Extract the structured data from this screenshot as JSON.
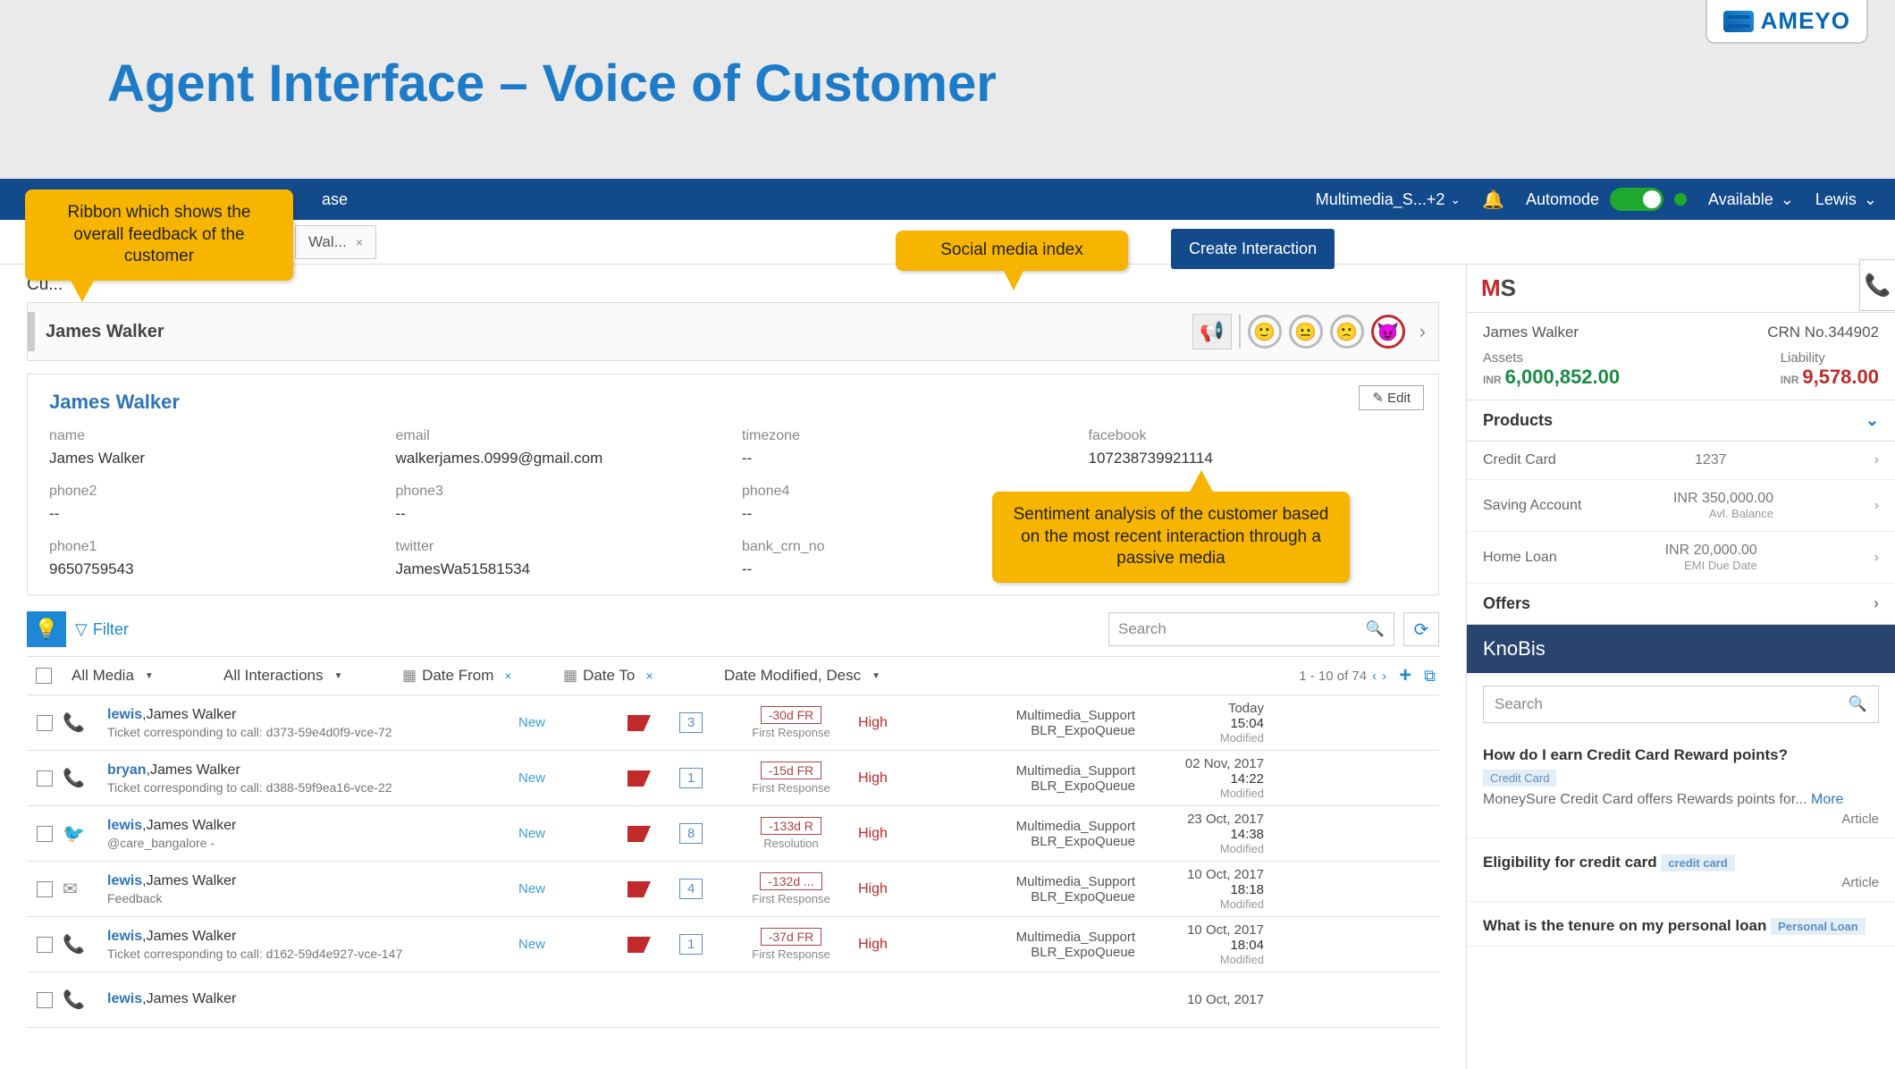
{
  "slide": {
    "title": "Agent Interface – Voice of Customer",
    "logo": "AMEYO"
  },
  "topbar": {
    "breadcrumb_suffix": "ase",
    "profile": "Multimedia_S...+2",
    "automode": "Automode",
    "status": "Available",
    "user": "Lewis"
  },
  "tab": {
    "label": "Wal...",
    "close": "×"
  },
  "create_btn": "Create Interaction",
  "cust_label": "Cu...",
  "ribbon": {
    "name": "James Walker"
  },
  "detail": {
    "title": "James Walker",
    "edit": "✎  Edit",
    "fields": [
      {
        "lbl": "name",
        "val": "James Walker"
      },
      {
        "lbl": "email",
        "val": "walkerjames.0999@gmail.com"
      },
      {
        "lbl": "timezone",
        "val": "--"
      },
      {
        "lbl": "facebook",
        "val": "107238739921114"
      },
      {
        "lbl": "phone2",
        "val": "--"
      },
      {
        "lbl": "phone3",
        "val": "--"
      },
      {
        "lbl": "phone4",
        "val": "--"
      },
      {
        "lbl": "",
        "val": ""
      },
      {
        "lbl": "phone1",
        "val": "9650759543"
      },
      {
        "lbl": "twitter",
        "val": "JamesWa51581534"
      },
      {
        "lbl": "bank_crn_no",
        "val": "--"
      },
      {
        "lbl": "",
        "val": ""
      }
    ]
  },
  "filter": {
    "label": "Filter",
    "search_ph": "Search"
  },
  "grid": {
    "media": "All Media",
    "interactions": "All Interactions",
    "date_from": "Date From",
    "date_to": "Date To",
    "sort": "Date Modified, Desc",
    "pager": "1 - 10 of 74"
  },
  "rows": [
    {
      "icon": "phone",
      "agent": "lewis",
      "name": "James Walker",
      "sub": "Ticket corresponding to call: d373-59e4d0f9-vce-72",
      "status": "New",
      "count": "3",
      "badge": "-30d FR",
      "bsub": "First Response",
      "pri": "High",
      "q1": "Multimedia_Support",
      "q2": "BLR_ExpoQueue",
      "d1": "Today",
      "d2": "15:04",
      "d3": "Modified"
    },
    {
      "icon": "phone",
      "agent": "bryan",
      "name": "James Walker",
      "sub": "Ticket corresponding to call: d388-59f9ea16-vce-22",
      "status": "New",
      "count": "1",
      "badge": "-15d FR",
      "bsub": "First Response",
      "pri": "High",
      "q1": "Multimedia_Support",
      "q2": "BLR_ExpoQueue",
      "d1": "02 Nov, 2017",
      "d2": "14:22",
      "d3": "Modified"
    },
    {
      "icon": "twitter",
      "agent": "lewis",
      "name": "James Walker",
      "sub": "@care_bangalore -",
      "status": "New",
      "count": "8",
      "badge": "-133d R",
      "bsub": "Resolution",
      "pri": "High",
      "q1": "Multimedia_Support",
      "q2": "BLR_ExpoQueue",
      "d1": "23 Oct, 2017",
      "d2": "14:38",
      "d3": "Modified"
    },
    {
      "icon": "email",
      "agent": "lewis",
      "name": "James Walker",
      "sub": "Feedback",
      "status": "New",
      "count": "4",
      "badge": "-132d ...",
      "bsub": "First Response",
      "pri": "High",
      "q1": "Multimedia_Support",
      "q2": "BLR_ExpoQueue",
      "d1": "10 Oct, 2017",
      "d2": "18:18",
      "d3": "Modified"
    },
    {
      "icon": "phone",
      "agent": "lewis",
      "name": "James Walker",
      "sub": "Ticket corresponding to call: d162-59d4e927-vce-147",
      "status": "New",
      "count": "1",
      "badge": "-37d FR",
      "bsub": "First Response",
      "pri": "High",
      "q1": "Multimedia_Support",
      "q2": "BLR_ExpoQueue",
      "d1": "10 Oct, 2017",
      "d2": "18:04",
      "d3": "Modified"
    },
    {
      "icon": "phone",
      "agent": "lewis",
      "name": "James Walker",
      "sub": "",
      "status": "",
      "count": "",
      "badge": "",
      "bsub": "",
      "pri": "",
      "q1": "",
      "q2": "",
      "d1": "10 Oct, 2017",
      "d2": "",
      "d3": ""
    }
  ],
  "side": {
    "name": "James Walker",
    "crn": "CRN No.344902",
    "assets_lbl": "Assets",
    "assets": "6,000,852.00",
    "liab_lbl": "Liability",
    "liab": "9,578.00",
    "products_h": "Products",
    "products": [
      {
        "name": "Credit Card",
        "val": "1237",
        "sub": ""
      },
      {
        "name": "Saving Account",
        "val": "INR 350,000.00",
        "sub": "Avl. Balance"
      },
      {
        "name": "Home Loan",
        "val": "INR 20,000.00",
        "sub": "EMI Due Date"
      }
    ],
    "offers_h": "Offers"
  },
  "kb": {
    "title": "KnoBis",
    "search_ph": "Search",
    "items": [
      {
        "q": "How do I earn Credit Card Reward points?",
        "tag": "Credit Card",
        "desc": "MoneySure Credit Card offers Rewards points for... ",
        "more": "More",
        "type": "Article"
      },
      {
        "q": "Eligibility for credit card",
        "tag": "credit card",
        "desc": "",
        "more": "",
        "type": "Article"
      },
      {
        "q": "What is the tenure on my personal loan",
        "tag": "Personal Loan",
        "desc": "",
        "more": "",
        "type": ""
      }
    ]
  },
  "callouts": {
    "c1": "Ribbon which shows the overall feedback of the customer",
    "c2": "Social media index",
    "c3": "Sentiment analysis of the customer based on the most recent interaction through a passive media"
  }
}
